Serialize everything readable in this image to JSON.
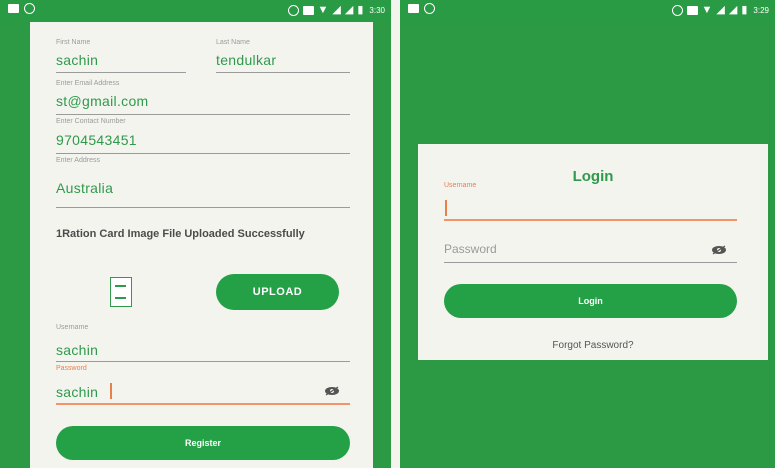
{
  "left_status_bar": {
    "time": "3:30"
  },
  "right_status_bar": {
    "time": "3:29"
  },
  "register": {
    "first_name_label": "First Name",
    "first_name_value": "sachin",
    "last_name_label": "Last Name",
    "last_name_value": "tendulkar",
    "email_label": "Enter Email Address",
    "email_value": "st@gmail.com",
    "contact_label": "Enter Contact Number",
    "contact_value": "9704543451",
    "address_label": "Enter Address",
    "address_value": "Australia",
    "upload_message": "1Ration Card Image File Uploaded Successfully",
    "upload_button": "UPLOAD",
    "username_label": "Username",
    "username_value": "sachin",
    "password_label": "Password",
    "password_value": "sachin",
    "register_button": "Register"
  },
  "login": {
    "title": "Login",
    "username_label": "Username",
    "username_value": "",
    "password_placeholder": "Password",
    "login_button": "Login",
    "forgot_password": "Forgot Password?"
  },
  "colors": {
    "primary_green": "#2c9a45",
    "accent_orange": "#e8804e",
    "card_bg": "#f4f4ef"
  },
  "icons": [
    "visibility-off-icon",
    "document-icon",
    "wifi-icon",
    "battery-icon",
    "signal-icon"
  ]
}
